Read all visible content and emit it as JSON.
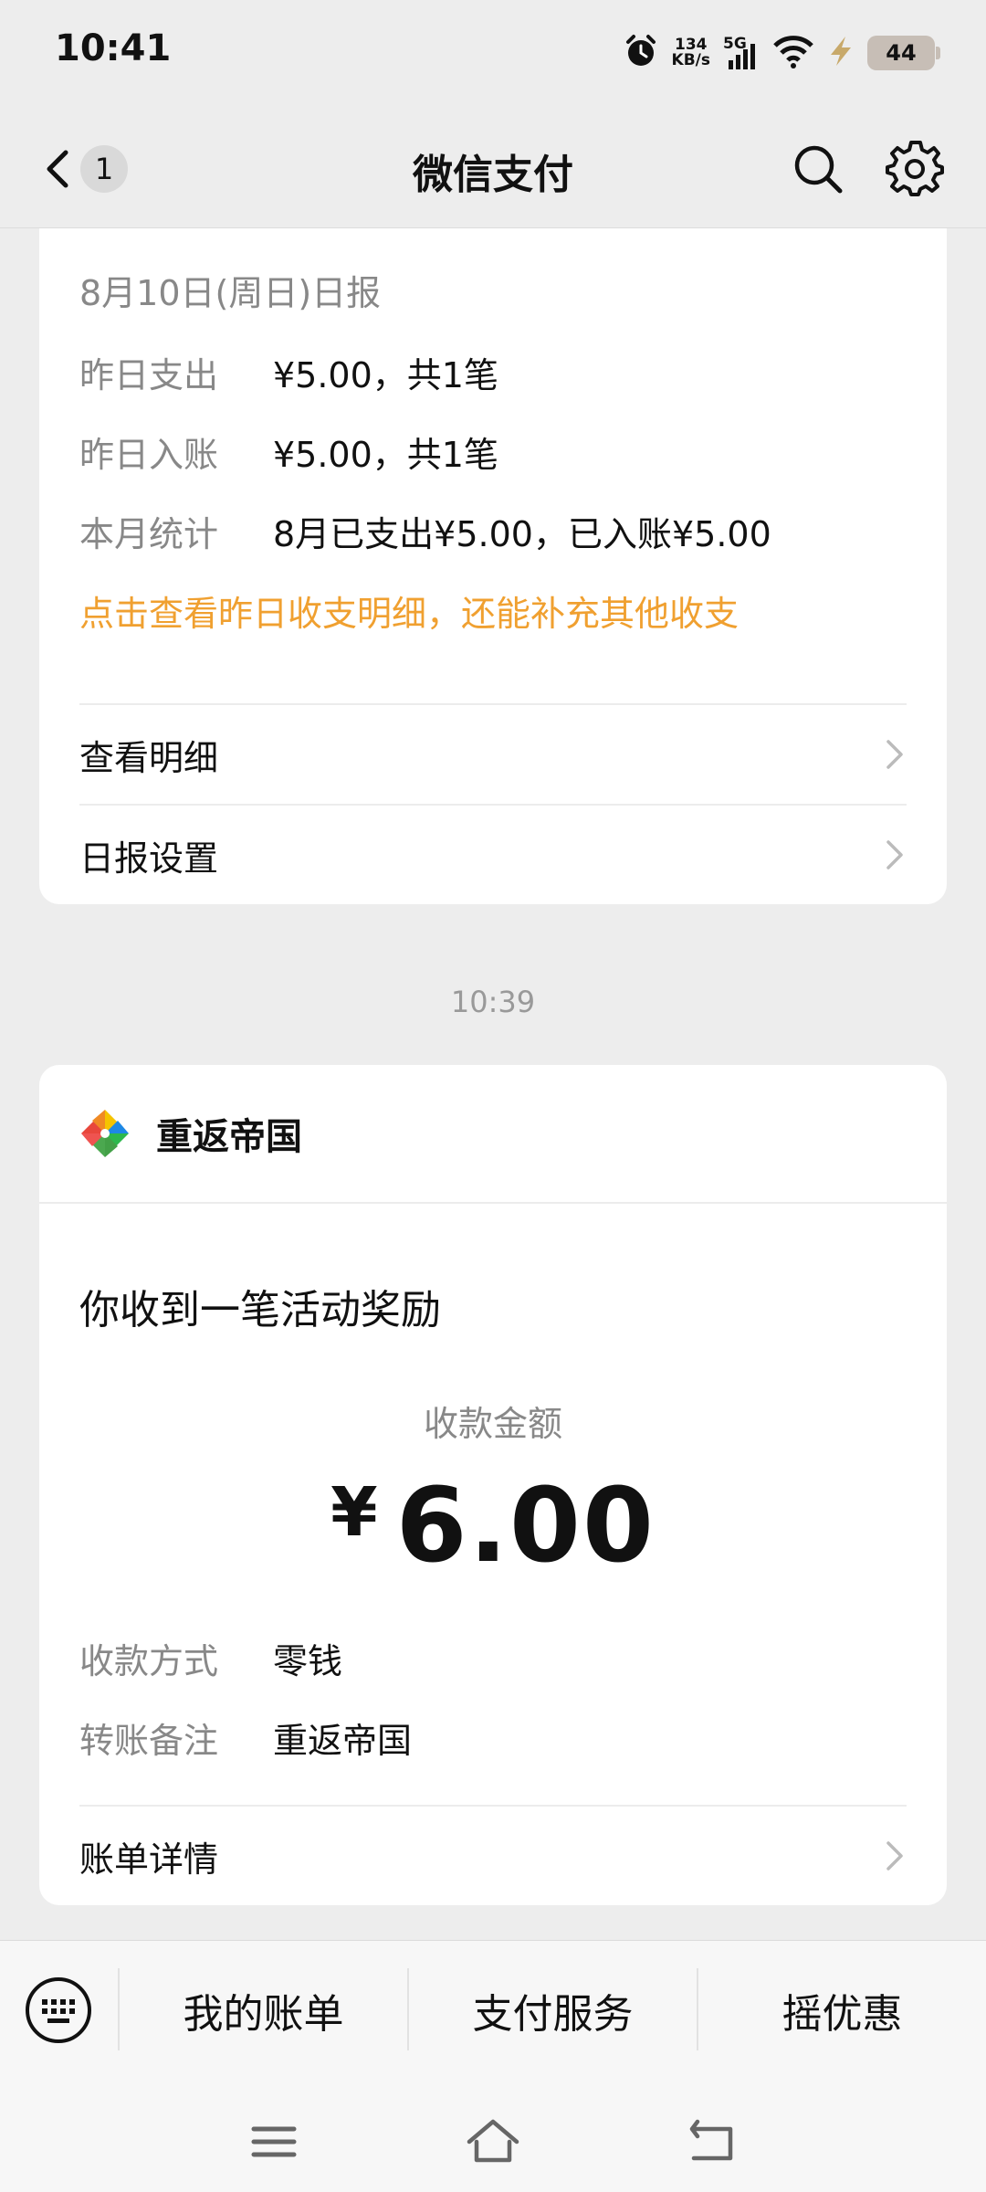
{
  "status_bar": {
    "time": "10:41",
    "net_speed_value": "134",
    "net_speed_unit": "KB/s",
    "network": "5G",
    "battery": "44"
  },
  "nav": {
    "unread_count": "1",
    "title": "微信支付"
  },
  "daily_report": {
    "date": "8月10日(周日)日报",
    "rows": [
      {
        "label": "昨日支出",
        "value": "¥5.00，共1笔"
      },
      {
        "label": "昨日入账",
        "value": "¥5.00，共1笔"
      },
      {
        "label": "本月统计",
        "value": "8月已支出¥5.00，已入账¥5.00"
      }
    ],
    "link": "点击查看昨日收支明细，还能补充其他收支",
    "menu": [
      {
        "label": "查看明细"
      },
      {
        "label": "日报设置"
      }
    ]
  },
  "timestamp": "10:39",
  "receipt": {
    "merchant": "重返帝国",
    "title": "你收到一笔活动奖励",
    "amount_label": "收款金额",
    "currency": "¥",
    "amount": "6.00",
    "rows": [
      {
        "label": "收款方式",
        "value": "零钱"
      },
      {
        "label": "转账备注",
        "value": "重返帝国"
      }
    ],
    "detail_label": "账单详情"
  },
  "bottom_menu": {
    "items": [
      "我的账单",
      "支付服务",
      "摇优惠"
    ]
  },
  "colors": {
    "accent_orange": "#f0a030",
    "background": "#ededed"
  }
}
